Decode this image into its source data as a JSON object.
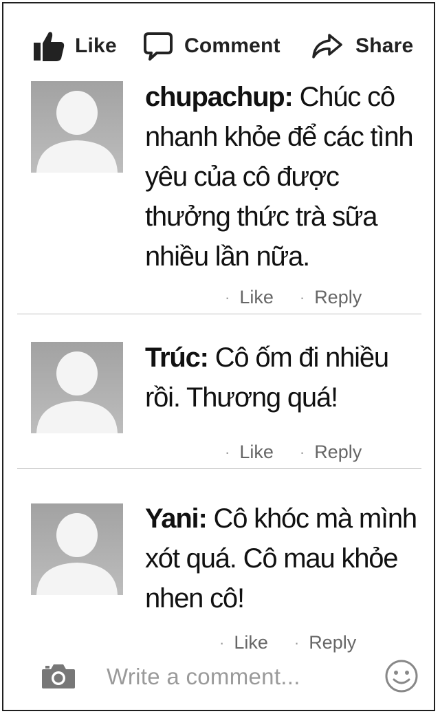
{
  "actions": {
    "like_label": "Like",
    "comment_label": "Comment",
    "share_label": "Share",
    "like_icon": "thumbs-up-icon",
    "comment_icon": "speech-bubble-icon",
    "share_icon": "share-arrow-icon"
  },
  "comments": [
    {
      "author": "chupachup:",
      "text": " Chúc cô nhanh khỏe để các tình yêu của cô được thưởng thức trà sữa nhiều lần nữa.",
      "like_label": "Like",
      "reply_label": "Reply"
    },
    {
      "author": "Trúc:",
      "text": " Cô ốm đi nhiều rồi. Thương quá!",
      "like_label": "Like",
      "reply_label": "Reply"
    },
    {
      "author": "Yani:",
      "text": " Cô khóc mà mình xót quá. Cô mau khỏe nhen cô!",
      "like_label": "Like",
      "reply_label": "Reply"
    }
  ],
  "composer": {
    "placeholder": "Write a comment...",
    "camera_icon": "camera-icon",
    "emoji_icon": "smiley-icon"
  },
  "colors": {
    "border": "#1f1f1f",
    "avatar_bg": "#a9a9a9",
    "meta_text": "#666666",
    "placeholder": "#9a9a9a"
  }
}
